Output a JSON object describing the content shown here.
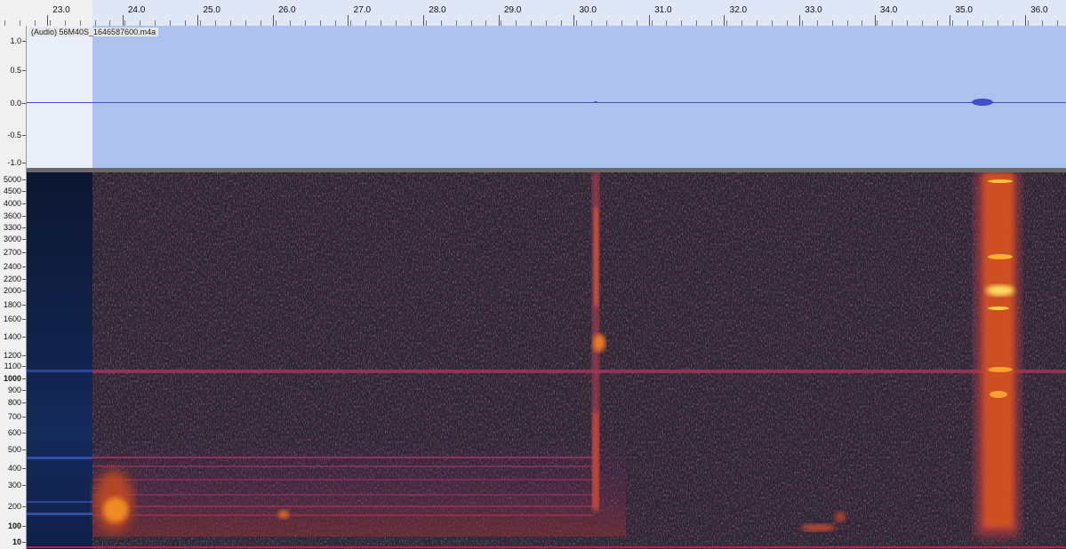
{
  "timeline": {
    "labels": [
      "23.0",
      "24.0",
      "25.0",
      "26.0",
      "27.0",
      "28.0",
      "29.0",
      "30.0",
      "31.0",
      "32.0",
      "33.0",
      "34.0",
      "35.0",
      "36.0"
    ]
  },
  "track": {
    "name": "(Audio) 56M40S_1646587600.m4a",
    "amplitude_labels": [
      "1.0",
      "0.5",
      "0.0",
      "-0.5",
      "-1.0"
    ]
  },
  "spectrogram": {
    "freq_labels": [
      "5000",
      "4500",
      "4000",
      "3600",
      "3300",
      "3000",
      "2700",
      "2400",
      "2200",
      "2000",
      "1800",
      "1600",
      "1400",
      "1200",
      "1100",
      "1000",
      "900",
      "800",
      "700",
      "600",
      "500",
      "400",
      "300",
      "200",
      "100",
      "10"
    ]
  },
  "colors": {
    "selection": "#aec2ef",
    "waveform": "#3e4fc9",
    "spectrogram_bg": "#2a2630"
  }
}
